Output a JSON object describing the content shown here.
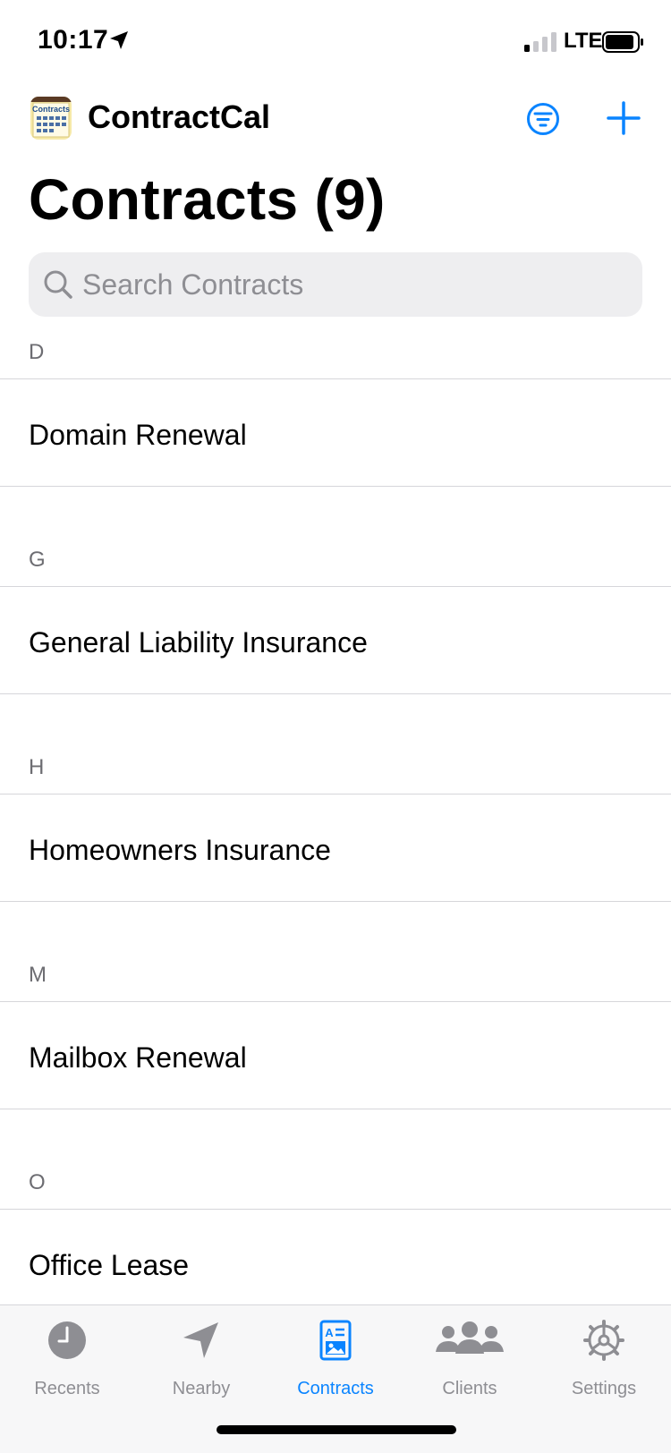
{
  "status_bar": {
    "time": "10:17",
    "network": "LTE"
  },
  "header": {
    "app_name": "ContractCal",
    "app_icon_text": "Contracts",
    "title": "Contracts (9)"
  },
  "search": {
    "placeholder": "Search Contracts",
    "value": ""
  },
  "sections": [
    {
      "letter": "D",
      "items": [
        "Domain Renewal"
      ]
    },
    {
      "letter": "G",
      "items": [
        "General Liability Insurance"
      ]
    },
    {
      "letter": "H",
      "items": [
        "Homeowners Insurance"
      ]
    },
    {
      "letter": "M",
      "items": [
        "Mailbox Renewal"
      ]
    },
    {
      "letter": "O",
      "items": [
        "Office Lease"
      ]
    }
  ],
  "tabs": [
    {
      "label": "Recents",
      "icon": "clock-icon"
    },
    {
      "label": "Nearby",
      "icon": "location-arrow-icon"
    },
    {
      "label": "Contracts",
      "icon": "contract-card-icon"
    },
    {
      "label": "Clients",
      "icon": "people-icon"
    },
    {
      "label": "Settings",
      "icon": "gear-icon"
    }
  ],
  "colors": {
    "accent": "#0a84ff",
    "inactive": "#8e8e93",
    "separator": "#d6d6da"
  }
}
